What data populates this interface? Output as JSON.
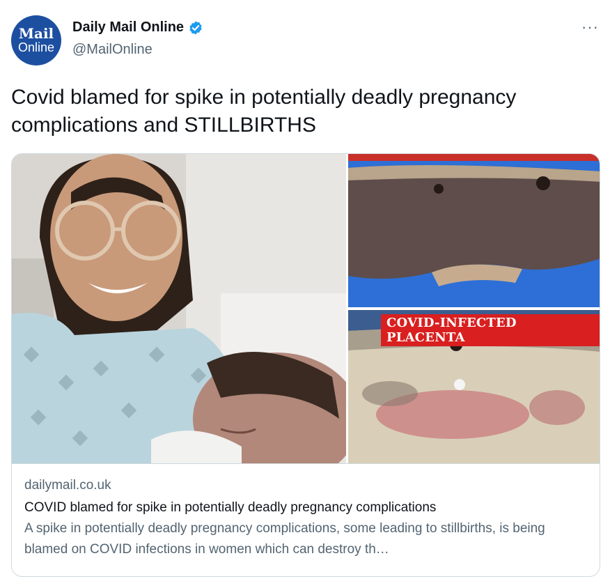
{
  "author": {
    "avatar_line1": "Mail",
    "avatar_line2": "Online",
    "name": "Daily Mail Online",
    "handle": "@MailOnline",
    "verified_icon": "verified-badge-icon"
  },
  "more_menu": "···",
  "tweet": {
    "text": "Covid blamed for spike in potentially deadly pregnancy complications and STILLBIRTHS"
  },
  "card": {
    "image_label": "COVID-INFECTED PLACENTA",
    "domain": "dailymail.co.uk",
    "title": "COVID blamed for spike in potentially deadly pregnancy complications",
    "description": "A spike in potentially deadly pregnancy complications, some leading to stillbirths, is being blamed on COVID infections in women which can destroy th…"
  },
  "colors": {
    "avatar_bg": "#1d4fa1",
    "verified": "#1d9bf0",
    "label_bg": "#d91f1f",
    "muted_text": "#536471"
  }
}
